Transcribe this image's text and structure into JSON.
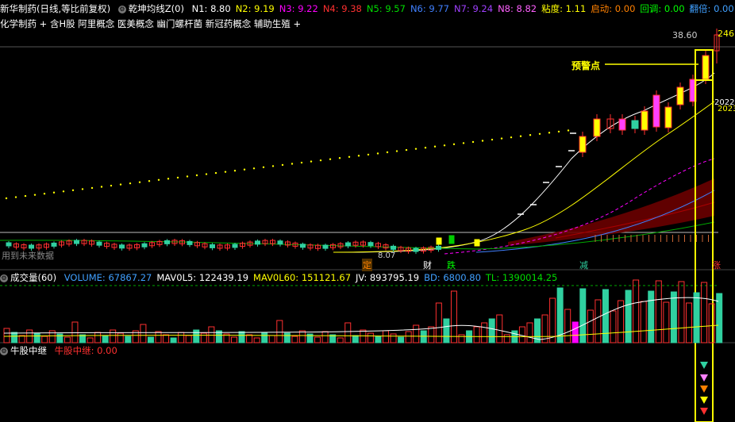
{
  "main_header": {
    "title": "新华制药(日线,等比前复权)",
    "indicator_name": "乾坤均线Z(0)",
    "params": [
      {
        "label": "N1: 8.80",
        "color": "#ffffff"
      },
      {
        "label": "N2: 9.19",
        "color": "#ffff00"
      },
      {
        "label": "N3: 9.22",
        "color": "#ff00ff"
      },
      {
        "label": "N4: 9.38",
        "color": "#ff3030"
      },
      {
        "label": "N5: 9.57",
        "color": "#00dd00"
      },
      {
        "label": "N6: 9.77",
        "color": "#4080ff"
      },
      {
        "label": "N7: 9.24",
        "color": "#a040ff"
      },
      {
        "label": "N8: 8.82",
        "color": "#ff60ff"
      },
      {
        "label": "粘度: 1.11",
        "color": "#ffff00"
      },
      {
        "label": "启动: 0.00",
        "color": "#ff8000"
      },
      {
        "label": "回调: 0.00",
        "color": "#00ff00"
      },
      {
        "label": "翻倍: 0.00",
        "color": "#40a0ff"
      },
      {
        "label": "LOWE",
        "color": "#40a0ff"
      }
    ]
  },
  "concepts": "化学制药 + 含H股 阿里概念 医美概念 幽门螺杆菌 新冠药概念 辅助生殖 +",
  "price_labels": {
    "top_right": "38.60",
    "top_right_yellow": "246",
    "mid_right_1": "2022",
    "mid_right_2": "2023",
    "low_price": "8.07",
    "warning": "预警点",
    "future_data": "用到未来数据"
  },
  "markers": {
    "ding": "定",
    "cai": "财",
    "die": "跌",
    "jian": "减",
    "zhang": "涨"
  },
  "volume_header": {
    "title": "成交量(60)",
    "items": [
      {
        "label": "VOLUME: 67867.27",
        "color": "#40a0ff"
      },
      {
        "label": "MAV0L5: 122439.19",
        "color": "#ffffff"
      },
      {
        "label": "MAV0L60: 151121.67",
        "color": "#ffff00"
      },
      {
        "label": "JV: 893795.19",
        "color": "#ffffff"
      },
      {
        "label": "BD: 6800.80",
        "color": "#40a0ff"
      },
      {
        "label": "TL: 1390014.25",
        "color": "#00dd00"
      }
    ]
  },
  "bull_header": {
    "title": "牛股中继",
    "value_label": "牛股中继: 0.00"
  },
  "colors": {
    "up": "#ff3030",
    "down": "#30d0a0",
    "yellow": "#ffff00",
    "bg": "#000000"
  }
}
